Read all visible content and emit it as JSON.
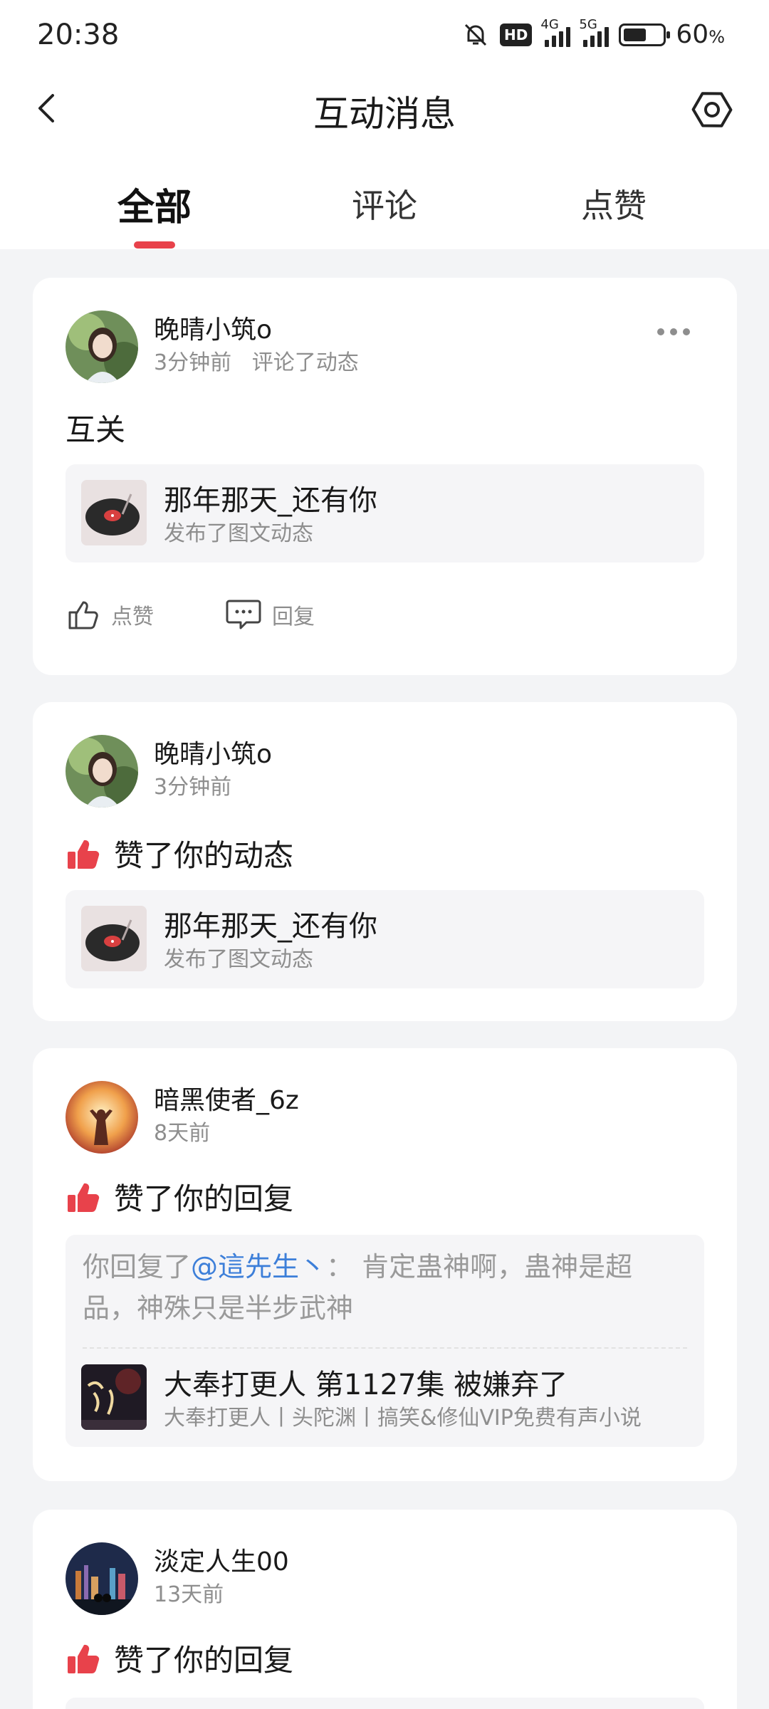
{
  "status_bar": {
    "time": "20:38",
    "hd": "HD",
    "net1": "4G",
    "net2": "5G",
    "battery": "60",
    "battery_unit": "%",
    "battery_level": 0.6
  },
  "header": {
    "title": "互动消息"
  },
  "tabs": [
    {
      "label": "全部",
      "active": true
    },
    {
      "label": "评论",
      "active": false
    },
    {
      "label": "点赞",
      "active": false
    }
  ],
  "cards": [
    {
      "user": "晚晴小筑o",
      "time": "3分钟前",
      "action": "评论了动态",
      "text": "互关",
      "quote_title": "那年那天_还有你",
      "quote_sub": "发布了图文动态",
      "like_label": "点赞",
      "reply_label": "回复"
    },
    {
      "user": "晚晴小筑o",
      "time": "3分钟前",
      "text": "赞了你的动态",
      "quote_title": "那年那天_还有你",
      "quote_sub": "发布了图文动态"
    },
    {
      "user": "暗黑使者_6z",
      "time": "8天前",
      "text": "赞了你的回复",
      "reply_prefix": "你回复了",
      "reply_mention": "@這先生丶",
      "reply_body": "： 肯定蛊神啊，蛊神是超品，神殊只是半步武神",
      "quote_title": "大奉打更人 第1127集 被嫌弃了",
      "quote_sub": "大奉打更人丨头陀渊丨搞笑&修仙VIP免费有声小说"
    },
    {
      "user": "淡定人生00",
      "time": "13天前",
      "text": "赞了你的回复"
    }
  ],
  "colors": {
    "accent": "#e8424b",
    "mention": "#3d7fd9",
    "background": "#f3f4f6"
  }
}
